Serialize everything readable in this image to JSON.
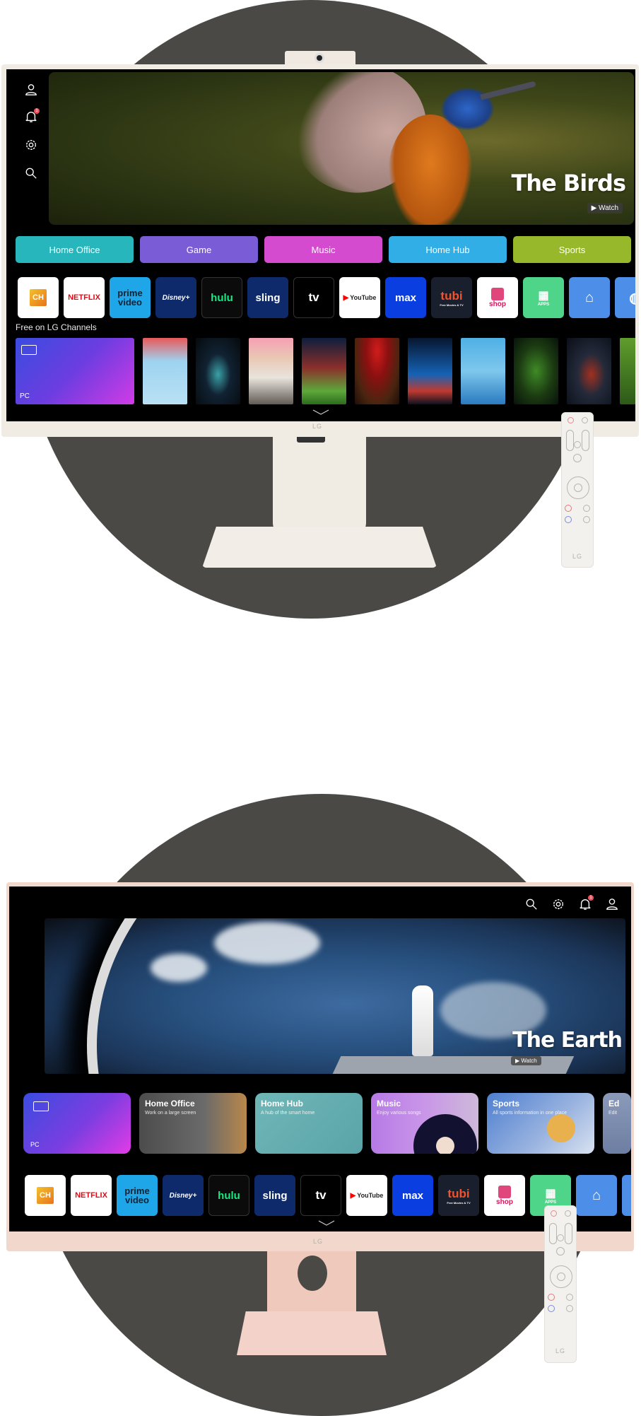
{
  "monitor_1": {
    "color_variant": "white",
    "sidebar_icons": [
      {
        "icon": "user-icon"
      },
      {
        "icon": "bell-icon",
        "badge": "1"
      },
      {
        "icon": "gear-icon"
      },
      {
        "icon": "search-icon"
      }
    ],
    "hero": {
      "title": "The Birds",
      "watch_label": "▶ Watch"
    },
    "categories": [
      {
        "label": "Home Office",
        "color": "#27b6bc"
      },
      {
        "label": "Game",
        "color": "#7a5cd6"
      },
      {
        "label": "Music",
        "color": "#d44bcf"
      },
      {
        "label": "Home Hub",
        "color": "#31aee6"
      },
      {
        "label": "Sports",
        "color": "#98b82c"
      }
    ],
    "apps": [
      {
        "name": "LG Channels",
        "label": "CH",
        "bg": "#ffffff",
        "fg": "#e8731f"
      },
      {
        "name": "Netflix",
        "label": "NETFLIX",
        "bg": "#ffffff",
        "fg": "#e50914"
      },
      {
        "name": "Prime Video",
        "label": "prime video",
        "bg": "#1fa6e8",
        "fg": "#0f2233"
      },
      {
        "name": "Disney+",
        "label": "Disney+",
        "bg": "#0e2a6b",
        "fg": "#ffffff"
      },
      {
        "name": "Hulu",
        "label": "hulu",
        "bg": "#0b0b0b",
        "fg": "#1ce783"
      },
      {
        "name": "Sling",
        "label": "sling",
        "bg": "#0e2a6b",
        "fg": "#ffffff"
      },
      {
        "name": "Apple TV",
        "label": "tv",
        "bg": "#000000",
        "fg": "#ffffff"
      },
      {
        "name": "YouTube",
        "label": "YouTube",
        "bg": "#ffffff",
        "fg": "#222222"
      },
      {
        "name": "Max",
        "label": "max",
        "bg": "#0a3ee0",
        "fg": "#ffffff"
      },
      {
        "name": "Tubi",
        "label": "tubi",
        "sublabel": "Free Movies & TV",
        "bg": "#1a1f2e",
        "fg": "#f0542d"
      },
      {
        "name": "Shop Time",
        "label": "shop",
        "bg": "#ffffff",
        "fg": "#d6165b"
      },
      {
        "name": "Apps",
        "label": "APPS",
        "bg": "#4fd58a",
        "fg": "#ffffff"
      },
      {
        "name": "Home",
        "label": "",
        "bg": "#4c8ee8",
        "fg": "#ffffff"
      },
      {
        "name": "Browser",
        "label": "",
        "bg": "#4c8ee8",
        "fg": "#ffffff"
      }
    ],
    "channels_label": "Free on LG Channels",
    "pc_label": "PC",
    "brand": "LG"
  },
  "monitor_2": {
    "color_variant": "pink",
    "top_icons": [
      {
        "icon": "search-icon"
      },
      {
        "icon": "gear-icon"
      },
      {
        "icon": "bell-icon",
        "badge": "1"
      },
      {
        "icon": "user-icon"
      }
    ],
    "hero": {
      "title": "The Earth",
      "watch_label": "▶ Watch"
    },
    "cards": [
      {
        "title": "",
        "subtitle": "",
        "label": "PC"
      },
      {
        "title": "Home Office",
        "subtitle": "Work on a large screen"
      },
      {
        "title": "Home Hub",
        "subtitle": "A hub of the smart home"
      },
      {
        "title": "Music",
        "subtitle": "Enjoy various songs"
      },
      {
        "title": "Sports",
        "subtitle": "All sports information in one place"
      },
      {
        "title": "Ed",
        "subtitle": "Edit"
      }
    ],
    "brand": "LG"
  },
  "remote_brand": "LG"
}
